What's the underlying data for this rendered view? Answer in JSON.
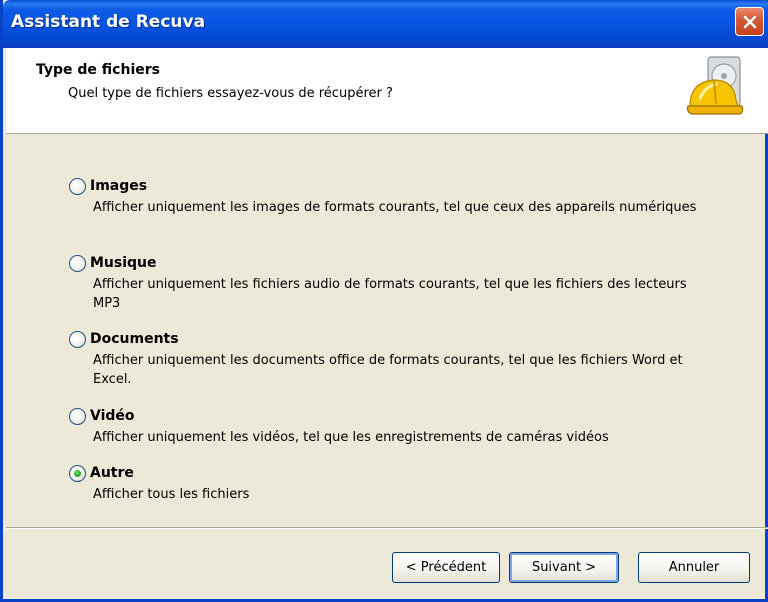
{
  "window": {
    "title": "Assistant de Recuva"
  },
  "header": {
    "title": "Type de fichiers",
    "subtitle": "Quel type de fichiers essayez-vous de récupérer ?",
    "icon": "recuva-hardhat-disk-icon"
  },
  "options": [
    {
      "label": "Images",
      "description": "Afficher uniquement les images de formats courants, tel que ceux des appareils numériques",
      "selected": false
    },
    {
      "label": "Musique",
      "description": "Afficher uniquement les fichiers audio de formats courants, tel que les fichiers des lecteurs MP3",
      "selected": false
    },
    {
      "label": "Documents",
      "description": "Afficher uniquement les documents office de formats courants, tel que les fichiers Word et Excel.",
      "selected": false
    },
    {
      "label": "Vidéo",
      "description": "Afficher uniquement les vidéos, tel que les enregistrements de caméras vidéos",
      "selected": false
    },
    {
      "label": "Autre",
      "description": "Afficher tous les fichiers",
      "selected": true
    }
  ],
  "buttons": {
    "previous": "< Précédent",
    "next": "Suivant >",
    "cancel": "Annuler"
  },
  "colors": {
    "titlebar": "#0654e0",
    "close": "#c4401e",
    "face": "#ece9d8",
    "radio_selected": "#21a121"
  }
}
